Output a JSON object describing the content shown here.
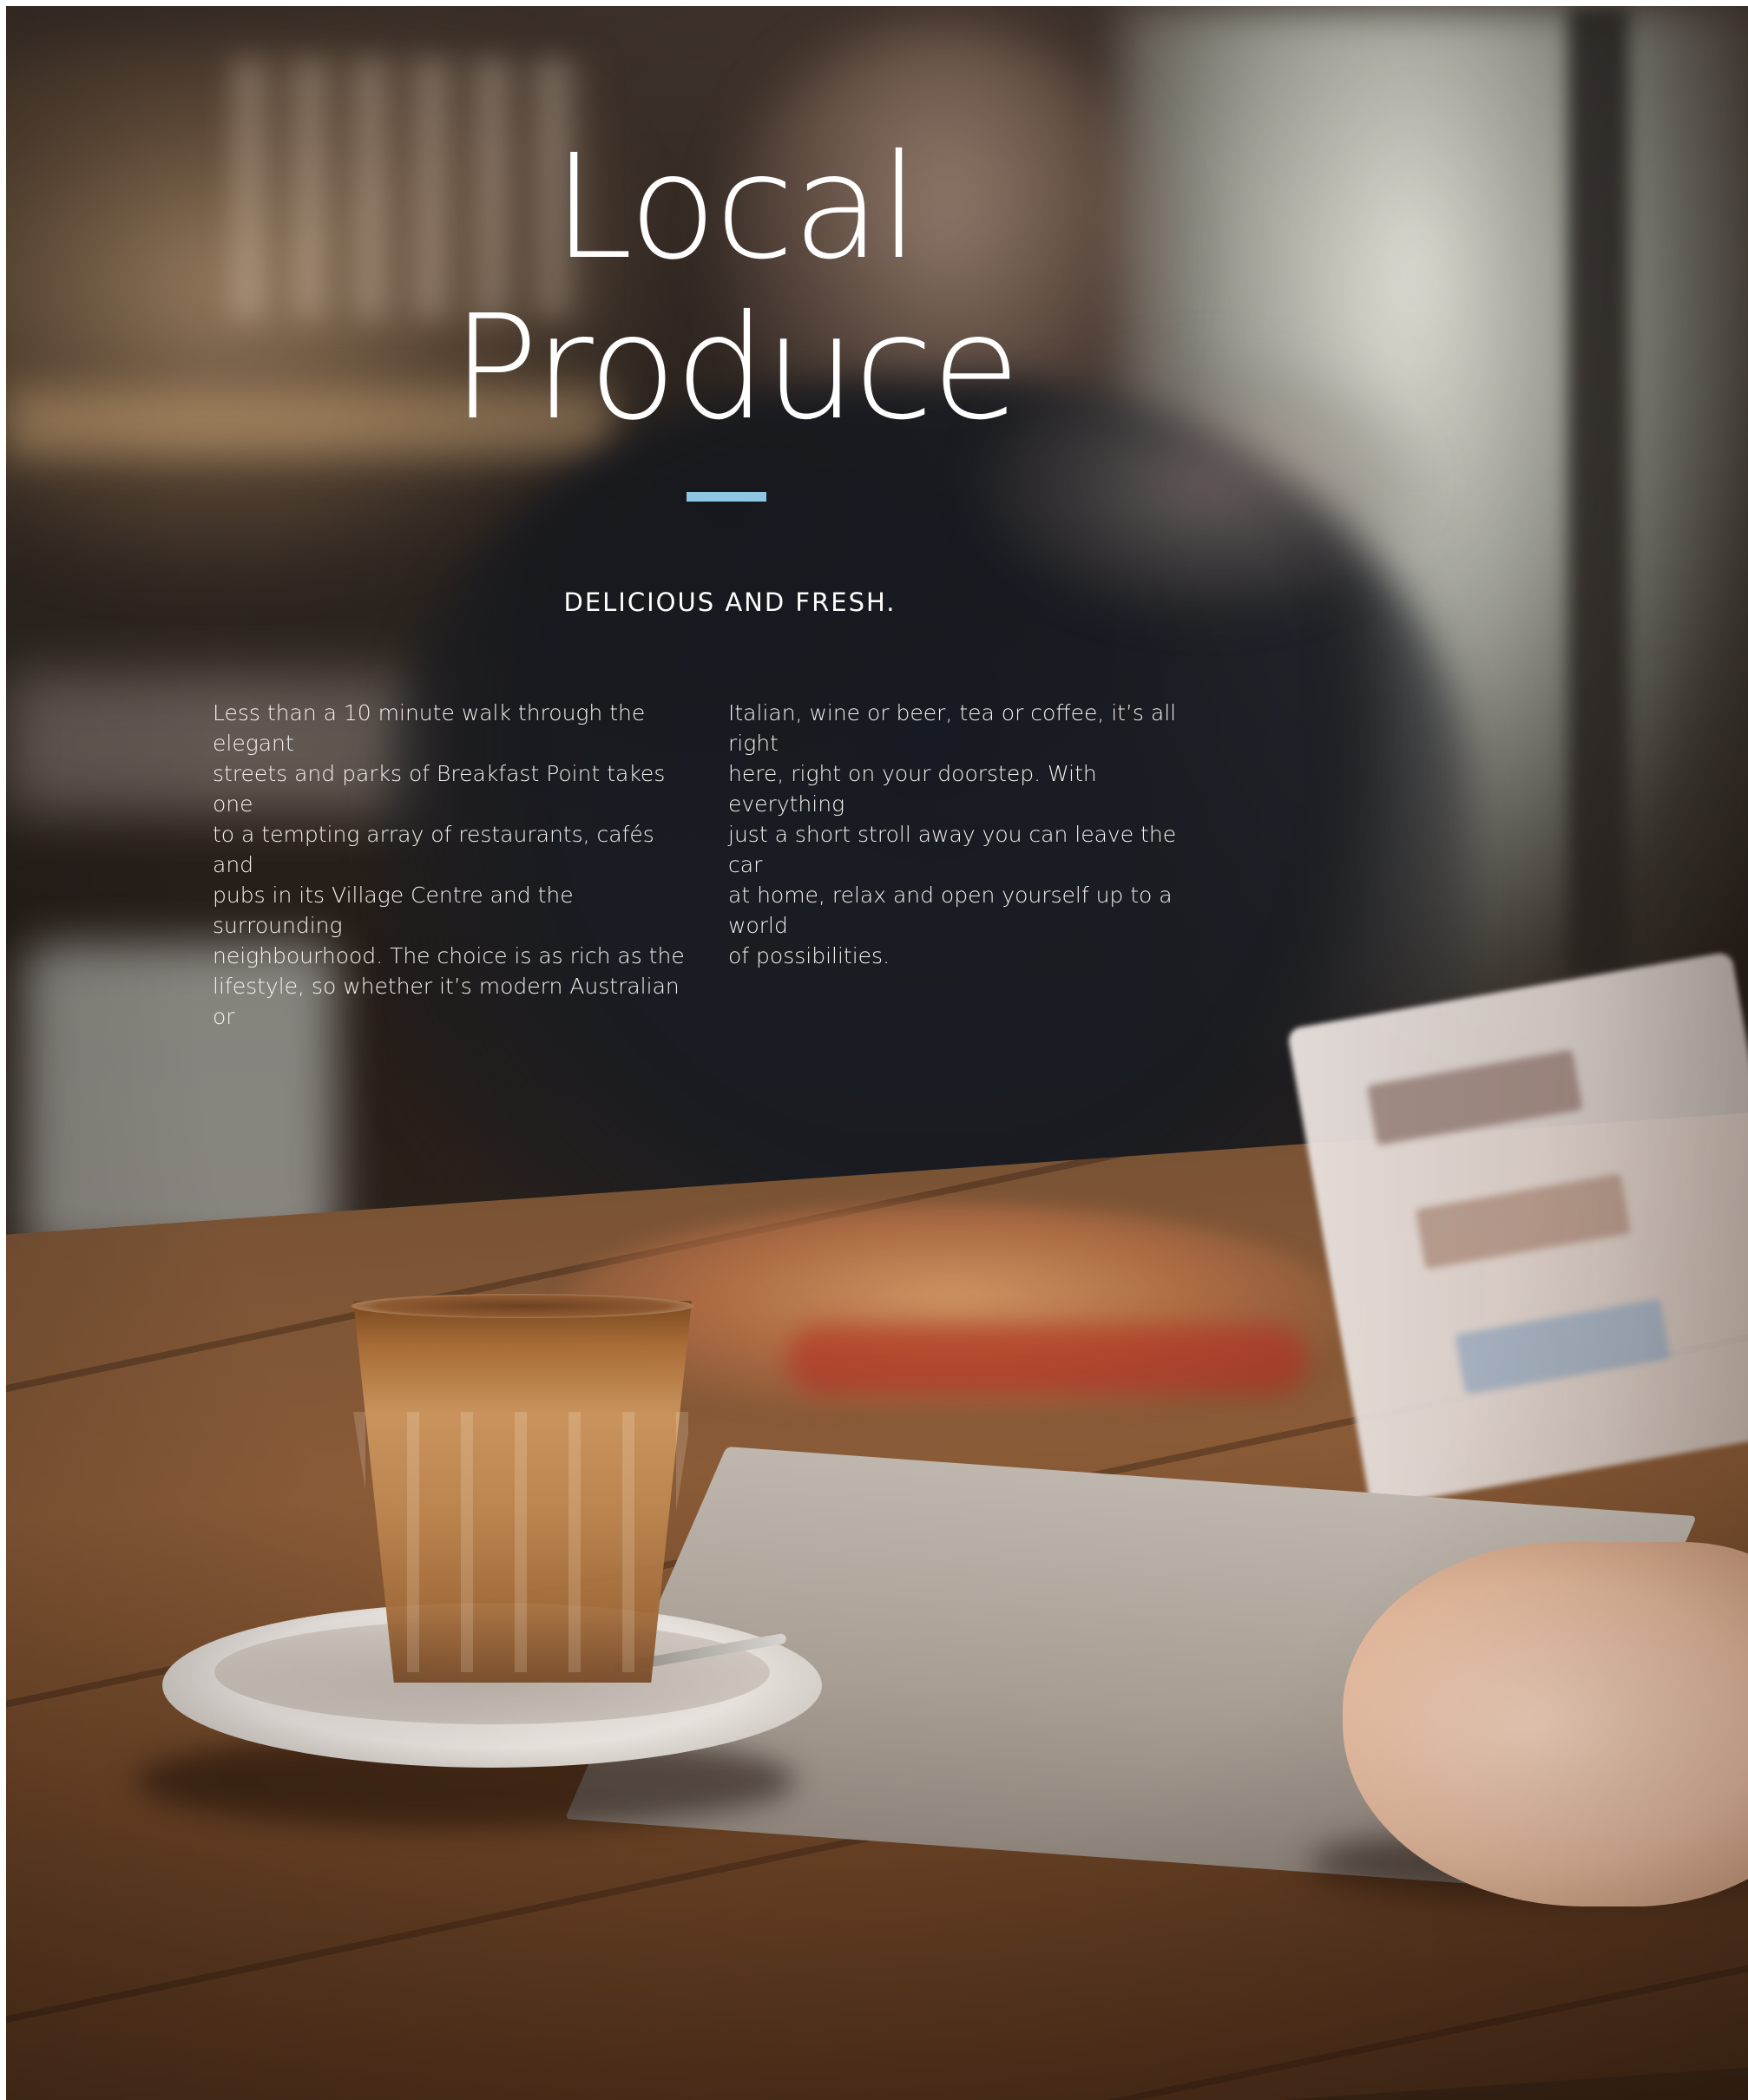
{
  "page": {
    "title_line1": "Local",
    "title_line2": "Produce",
    "subtitle": "DELICIOUS AND FRESH.",
    "accent_color": "#8ec5e0",
    "body_left_lines": [
      "Less than a 10 minute walk through the elegant",
      "streets and parks of Breakfast Point takes one",
      "to a tempting array of restaurants, cafés and",
      "pubs in its Village Centre and the surrounding",
      "neighbourhood. The choice is as rich as the",
      "lifestyle, so whether it’s modern Australian or"
    ],
    "body_right_lines": [
      "Italian, wine or beer, tea or coffee, it’s all right",
      "here, right on your doorstep. With everything",
      "just a short stroll away you can leave the car",
      "at home, relax and open yourself up to a world",
      "of possibilities."
    ]
  }
}
